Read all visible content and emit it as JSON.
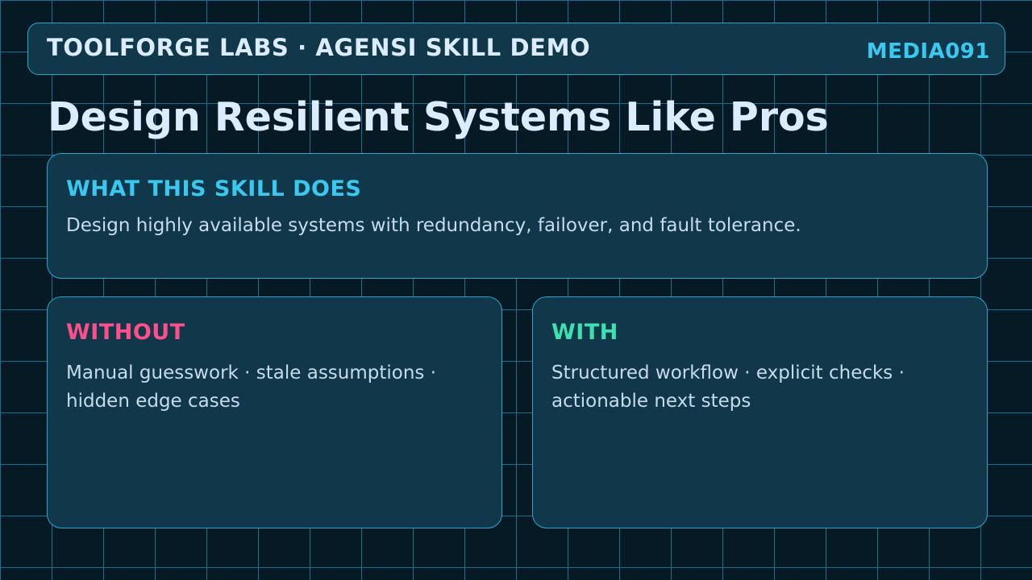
{
  "header": {
    "title": "TOOLFORGE LABS · AGENSI SKILL DEMO",
    "code": "MEDIA091"
  },
  "page_title": "Design Resilient Systems Like Pros",
  "what_card": {
    "heading": "WHAT THIS SKILL DOES",
    "body": "Design highly available systems with redundancy, failover, and fault tolerance."
  },
  "without_card": {
    "heading": "WITHOUT",
    "body": "Manual guesswork · stale assumptions · hidden edge cases"
  },
  "with_card": {
    "heading": "WITH",
    "body": "Structured workflow · explicit checks · actionable next steps"
  },
  "colors": {
    "background": "#061a26",
    "grid": "#1b6f8e",
    "panel": "#11384a",
    "accent_cyan": "#38c8f0",
    "without_pink": "#ff4f8b",
    "with_green": "#3fe0b0",
    "title_text": "#dcecff"
  }
}
